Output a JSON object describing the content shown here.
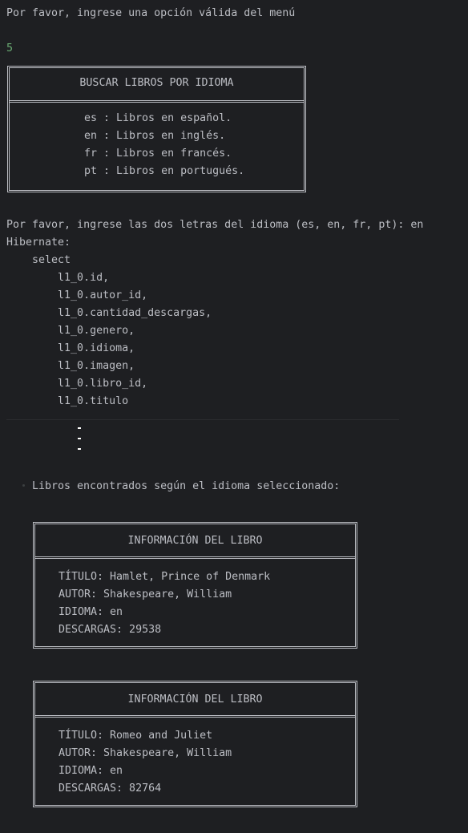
{
  "console": {
    "prompt_menu": "Por favor, ingrese una opción válida del menú",
    "input_option": "5",
    "language_box": {
      "title": "BUSCAR LIBROS POR IDIOMA",
      "options": [
        "es : Libros en español.",
        "en : Libros en inglés.",
        "fr : Libros en francés.",
        "pt : Libros en portugués."
      ]
    },
    "prompt_language": "Por favor, ingrese las dos letras del idioma (es, en, fr, pt): en",
    "hibernate_label": "Hibernate:",
    "sql_lines": [
      "    select",
      "        l1_0.id,",
      "        l1_0.autor_id,",
      "        l1_0.cantidad_descargas,",
      "        l1_0.genero,",
      "        l1_0.idioma,",
      "        l1_0.imagen,",
      "        l1_0.libro_id,",
      "        l1_0.titulo"
    ],
    "found_message": "Libros encontrados según el idioma seleccionado:",
    "books": [
      {
        "header": "INFORMACIÓN DEL LIBRO",
        "title_line": "TÍTULO: Hamlet, Prince of Denmark",
        "author_line": "AUTOR: Shakespeare, William",
        "language_line": "IDIOMA: en",
        "downloads_line": "DESCARGAS: 29538"
      },
      {
        "header": "INFORMACIÓN DEL LIBRO",
        "title_line": "TÍTULO: Romeo and Juliet",
        "author_line": "AUTOR: Shakespeare, William",
        "language_line": "IDIOMA: en",
        "downloads_line": "DESCARGAS: 82764"
      }
    ]
  },
  "colors": {
    "background": "#1e1f22",
    "text": "#bcbec4",
    "user_input": "#6aab73"
  }
}
